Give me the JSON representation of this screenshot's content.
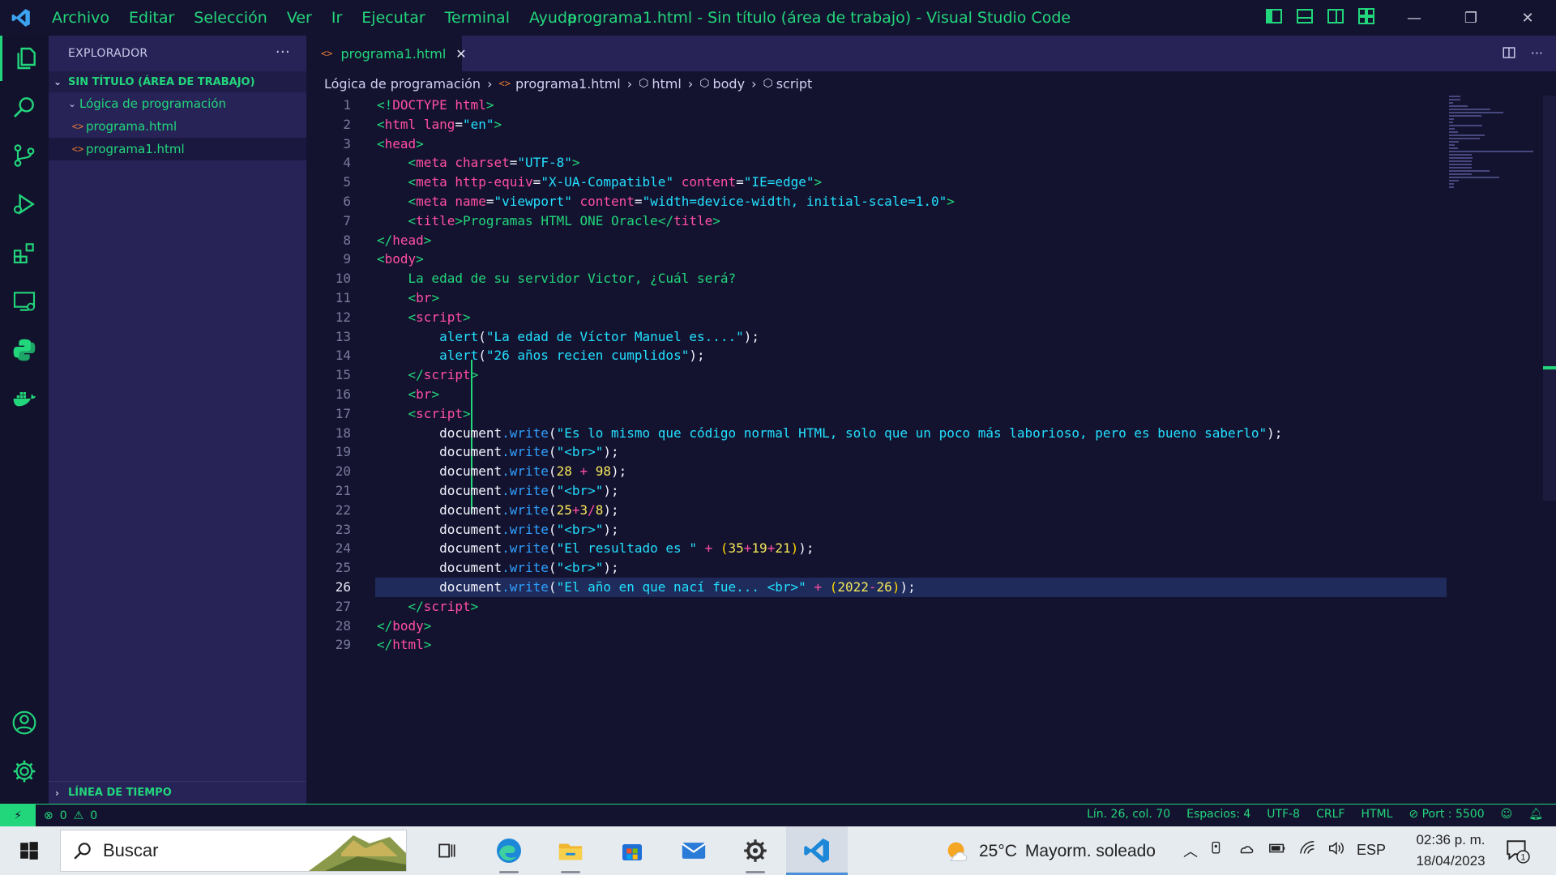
{
  "window": {
    "title": "programa1.html - Sin título (área de trabajo) - Visual Studio Code",
    "menu": [
      "Archivo",
      "Editar",
      "Selección",
      "Ver",
      "Ir",
      "Ejecutar",
      "Terminal",
      "Ayuda"
    ],
    "controls": {
      "minimize": "—",
      "restore": "❐",
      "close": "✕"
    }
  },
  "colors": {
    "accent": "#22d67b",
    "sidebar_bg": "#272357",
    "editor_bg": "#14132f",
    "file_icon": "#e37933"
  },
  "activity_bar": {
    "items": [
      "explorer-icon",
      "search-icon",
      "source-control-icon",
      "run-debug-icon",
      "extensions-icon",
      "remote-explorer-icon",
      "python-icon",
      "docker-icon"
    ],
    "bottom": [
      "accounts-icon",
      "manage-gear-icon"
    ]
  },
  "sidebar": {
    "title": "EXPLORADOR",
    "more": "···",
    "workspace": "SIN TÍTULO (ÁREA DE TRABAJO)",
    "folder": "Lógica de programación",
    "files": [
      "programa.html",
      "programa1.html"
    ],
    "timeline": "LÍNEA DE TIEMPO"
  },
  "tab": {
    "label": "programa1.html",
    "close": "✕"
  },
  "breadcrumb": [
    "Lógica de programación",
    "programa1.html",
    "html",
    "body",
    "script"
  ],
  "editor": {
    "current_line": 26,
    "line_numbers": [
      "1",
      "2",
      "3",
      "4",
      "5",
      "6",
      "7",
      "8",
      "9",
      "10",
      "11",
      "12",
      "13",
      "14",
      "15",
      "16",
      "17",
      "18",
      "19",
      "20",
      "21",
      "22",
      "23",
      "24",
      "25",
      "26",
      "27",
      "28",
      "29"
    ],
    "lines": [
      [
        [
          "p",
          "<!"
        ],
        [
          "t",
          "DOCTYPE"
        ],
        [
          "x",
          " "
        ],
        [
          "a",
          "html"
        ],
        [
          "p",
          ">"
        ]
      ],
      [
        [
          "p",
          "<"
        ],
        [
          "t",
          "html"
        ],
        [
          "x",
          " "
        ],
        [
          "a",
          "lang"
        ],
        [
          "o",
          "="
        ],
        [
          "s",
          "\"en\""
        ],
        [
          "p",
          ">"
        ]
      ],
      [
        [
          "p",
          "<"
        ],
        [
          "t",
          "head"
        ],
        [
          "p",
          ">"
        ]
      ],
      [
        [
          "x",
          "    "
        ],
        [
          "p",
          "<"
        ],
        [
          "t",
          "meta"
        ],
        [
          "x",
          " "
        ],
        [
          "a",
          "charset"
        ],
        [
          "o",
          "="
        ],
        [
          "s",
          "\"UTF-8\""
        ],
        [
          "p",
          ">"
        ]
      ],
      [
        [
          "x",
          "    "
        ],
        [
          "p",
          "<"
        ],
        [
          "t",
          "meta"
        ],
        [
          "x",
          " "
        ],
        [
          "a",
          "http-equiv"
        ],
        [
          "o",
          "="
        ],
        [
          "s",
          "\"X-UA-Compatible\""
        ],
        [
          "x",
          " "
        ],
        [
          "a",
          "content"
        ],
        [
          "o",
          "="
        ],
        [
          "s",
          "\"IE=edge\""
        ],
        [
          "p",
          ">"
        ]
      ],
      [
        [
          "x",
          "    "
        ],
        [
          "p",
          "<"
        ],
        [
          "t",
          "meta"
        ],
        [
          "x",
          " "
        ],
        [
          "a",
          "name"
        ],
        [
          "o",
          "="
        ],
        [
          "s",
          "\"viewport\""
        ],
        [
          "x",
          " "
        ],
        [
          "a",
          "content"
        ],
        [
          "o",
          "="
        ],
        [
          "s",
          "\"width=device-width, initial-scale=1.0\""
        ],
        [
          "p",
          ">"
        ]
      ],
      [
        [
          "x",
          "    "
        ],
        [
          "p",
          "<"
        ],
        [
          "t",
          "title"
        ],
        [
          "p",
          ">"
        ],
        [
          "x",
          "Programas HTML ONE Oracle"
        ],
        [
          "p",
          "</"
        ],
        [
          "t",
          "title"
        ],
        [
          "p",
          ">"
        ]
      ],
      [
        [
          "p",
          "</"
        ],
        [
          "t",
          "head"
        ],
        [
          "p",
          ">"
        ]
      ],
      [
        [
          "p",
          "<"
        ],
        [
          "t",
          "body"
        ],
        [
          "p",
          ">"
        ]
      ],
      [
        [
          "x",
          "    La edad de su servidor Victor, ¿Cuál será?"
        ]
      ],
      [
        [
          "x",
          "    "
        ],
        [
          "p",
          "<"
        ],
        [
          "t",
          "br"
        ],
        [
          "p",
          ">"
        ]
      ],
      [
        [
          "x",
          "    "
        ],
        [
          "p",
          "<"
        ],
        [
          "t",
          "script"
        ],
        [
          "p",
          ">"
        ]
      ],
      [
        [
          "x",
          "        "
        ],
        [
          "f",
          "alert"
        ],
        [
          "o",
          "("
        ],
        [
          "s",
          "\"La edad de Víctor Manuel es....\""
        ],
        [
          "o",
          ");"
        ]
      ],
      [
        [
          "x",
          "        "
        ],
        [
          "f",
          "alert"
        ],
        [
          "o",
          "("
        ],
        [
          "s",
          "\"26 años recien cumplidos\""
        ],
        [
          "o",
          ");"
        ]
      ],
      [
        [
          "x",
          "    "
        ],
        [
          "p",
          "</"
        ],
        [
          "t",
          "script"
        ],
        [
          "p",
          ">"
        ]
      ],
      [
        [
          "x",
          "    "
        ],
        [
          "p",
          "<"
        ],
        [
          "t",
          "br"
        ],
        [
          "p",
          ">"
        ]
      ],
      [
        [
          "x",
          "    "
        ],
        [
          "p",
          "<"
        ],
        [
          "t",
          "script"
        ],
        [
          "p",
          ">"
        ]
      ],
      [
        [
          "x",
          "        "
        ],
        [
          "o",
          "document"
        ],
        [
          "m",
          ".write"
        ],
        [
          "o",
          "("
        ],
        [
          "s",
          "\"Es lo mismo que código normal HTML, solo que un poco más laborioso, pero es bueno saberlo\""
        ],
        [
          "o",
          ");"
        ]
      ],
      [
        [
          "x",
          "        "
        ],
        [
          "o",
          "document"
        ],
        [
          "m",
          ".write"
        ],
        [
          "o",
          "("
        ],
        [
          "s",
          "\"<br>\""
        ],
        [
          "o",
          ");"
        ]
      ],
      [
        [
          "x",
          "        "
        ],
        [
          "o",
          "document"
        ],
        [
          "m",
          ".write"
        ],
        [
          "o",
          "("
        ],
        [
          "n",
          "28"
        ],
        [
          "o",
          " "
        ],
        [
          "op",
          "+"
        ],
        [
          "o",
          " "
        ],
        [
          "n",
          "98"
        ],
        [
          "o",
          ");"
        ]
      ],
      [
        [
          "x",
          "        "
        ],
        [
          "o",
          "document"
        ],
        [
          "m",
          ".write"
        ],
        [
          "o",
          "("
        ],
        [
          "s",
          "\"<br>\""
        ],
        [
          "o",
          ");"
        ]
      ],
      [
        [
          "x",
          "        "
        ],
        [
          "o",
          "document"
        ],
        [
          "m",
          ".write"
        ],
        [
          "o",
          "("
        ],
        [
          "n",
          "25"
        ],
        [
          "op",
          "+"
        ],
        [
          "n",
          "3"
        ],
        [
          "op",
          "/"
        ],
        [
          "n",
          "8"
        ],
        [
          "o",
          ");"
        ]
      ],
      [
        [
          "x",
          "        "
        ],
        [
          "o",
          "document"
        ],
        [
          "m",
          ".write"
        ],
        [
          "o",
          "("
        ],
        [
          "s",
          "\"<br>\""
        ],
        [
          "o",
          ");"
        ]
      ],
      [
        [
          "x",
          "        "
        ],
        [
          "o",
          "document"
        ],
        [
          "m",
          ".write"
        ],
        [
          "o",
          "("
        ],
        [
          "s",
          "\"El resultado es \""
        ],
        [
          "o",
          " "
        ],
        [
          "op",
          "+"
        ],
        [
          "o",
          " "
        ],
        [
          "pr",
          "("
        ],
        [
          "n",
          "35"
        ],
        [
          "op",
          "+"
        ],
        [
          "n",
          "19"
        ],
        [
          "op",
          "+"
        ],
        [
          "n",
          "21"
        ],
        [
          "pr",
          ")"
        ],
        [
          "o",
          ");"
        ]
      ],
      [
        [
          "x",
          "        "
        ],
        [
          "o",
          "document"
        ],
        [
          "m",
          ".write"
        ],
        [
          "o",
          "("
        ],
        [
          "s",
          "\"<br>\""
        ],
        [
          "o",
          ");"
        ]
      ],
      [
        [
          "x",
          "        "
        ],
        [
          "o",
          "document"
        ],
        [
          "m",
          ".write"
        ],
        [
          "o",
          "("
        ],
        [
          "s",
          "\"El año en que nací fue... <br>\""
        ],
        [
          "o",
          " "
        ],
        [
          "op",
          "+"
        ],
        [
          "o",
          " "
        ],
        [
          "pr",
          "("
        ],
        [
          "n",
          "2022"
        ],
        [
          "op",
          "-"
        ],
        [
          "n",
          "26"
        ],
        [
          "pr",
          ")"
        ],
        [
          "o",
          ");"
        ]
      ],
      [
        [
          "x",
          "    "
        ],
        [
          "p",
          "</"
        ],
        [
          "t",
          "script"
        ],
        [
          "p",
          ">"
        ]
      ],
      [
        [
          "p",
          "</"
        ],
        [
          "t",
          "body"
        ],
        [
          "p",
          ">"
        ]
      ],
      [
        [
          "p",
          "</"
        ],
        [
          "t",
          "html"
        ],
        [
          "p",
          ">"
        ]
      ]
    ]
  },
  "status_bar": {
    "remote": "⚡",
    "errors": "0",
    "warnings": "0",
    "position": "Lín. 26, col. 70",
    "spaces": "Espacios: 4",
    "encoding": "UTF-8",
    "eol": "CRLF",
    "language": "HTML",
    "port": "Port : 5500"
  },
  "taskbar": {
    "search_label": "Buscar",
    "apps": [
      "task-view-icon",
      "edge-icon",
      "file-explorer-icon",
      "store-icon",
      "mail-icon",
      "settings-icon",
      "vscode-icon"
    ],
    "weather_temp": "25°C",
    "weather_desc": "Mayorm. soleado",
    "language": "ESP",
    "time": "02:36 p. m.",
    "date": "18/04/2023",
    "notifications": "1"
  }
}
